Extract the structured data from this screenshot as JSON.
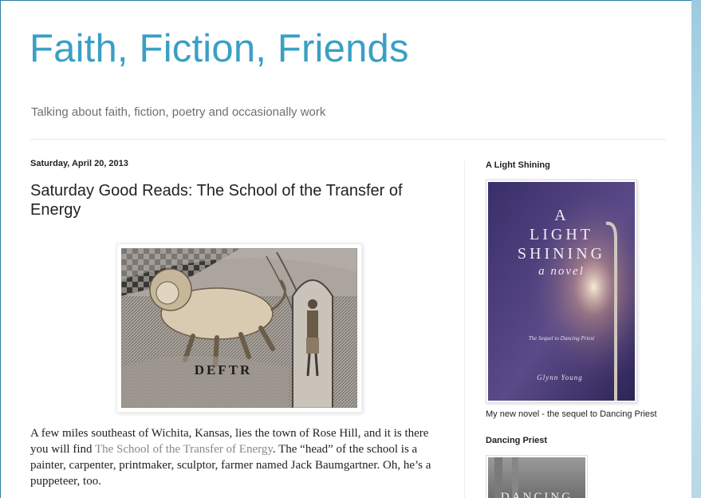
{
  "header": {
    "title": "Faith, Fiction, Friends",
    "description": "Talking about faith, fiction, poetry and occasionally work"
  },
  "post": {
    "date": "Saturday, April 20, 2013",
    "title": "Saturday Good Reads: The School of the Transfer of Energy",
    "image_word": "DEFTR",
    "body": {
      "before_link": "A few miles southeast of Wichita, Kansas, lies the town of Rose Hill, and it is there you will find ",
      "link": "The School of the Transfer of Energy",
      "after_link": ". The “head” of the school is a painter, carpenter, printmaker, sculptor, farmer named Jack Baumgartner. Oh, he’s a puppeteer, too."
    }
  },
  "sidebar": {
    "widget1": {
      "title": "A Light Shining",
      "cover": {
        "line1": "A",
        "line2": "LIGHT",
        "line3": "SHINING",
        "line4": "a novel",
        "subtitle": "The Sequel to Dancing Priest",
        "author": "Glynn Young"
      },
      "caption": "My new novel - the sequel to Dancing Priest"
    },
    "widget2": {
      "title": "Dancing Priest",
      "cover_text": "DANCING"
    }
  },
  "colors": {
    "title": "#3aa0c3",
    "link": "#888888",
    "page_border": "#2f7fa5"
  }
}
